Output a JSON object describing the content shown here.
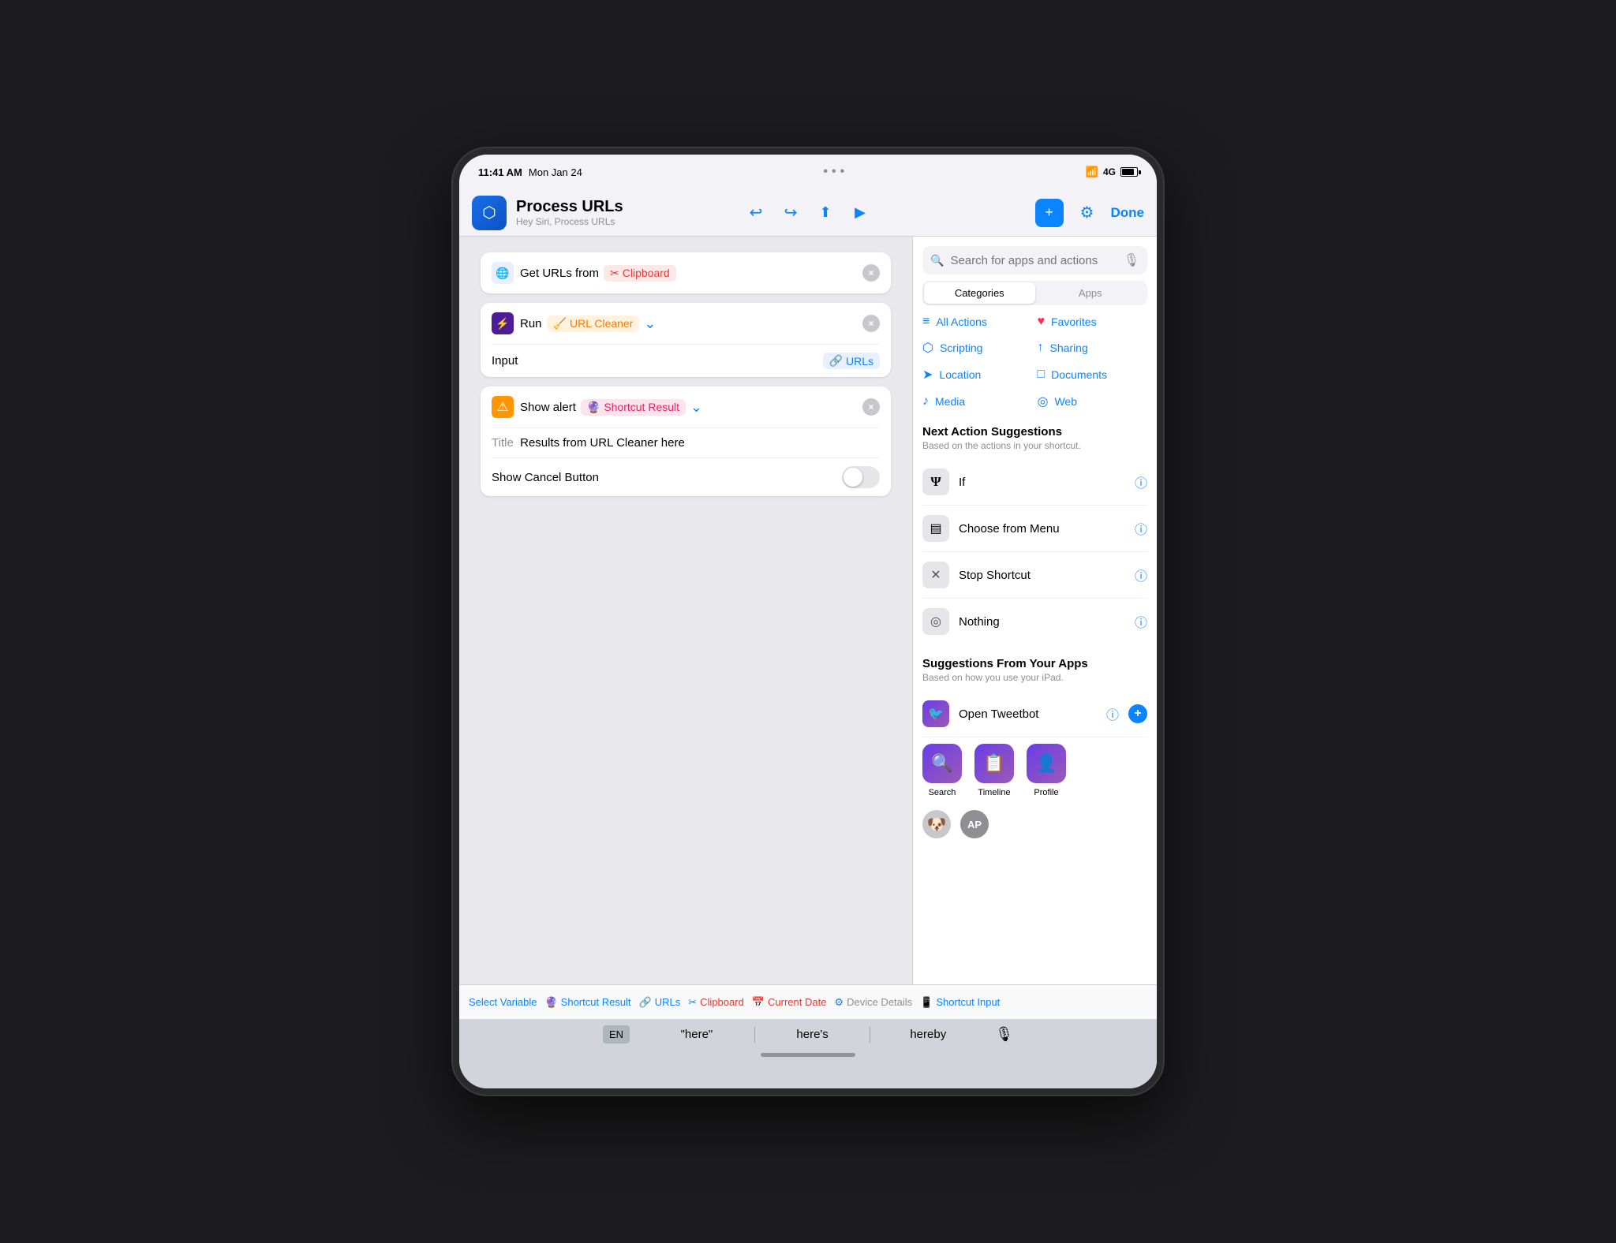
{
  "status_bar": {
    "time": "11:41 AM",
    "date": "Mon Jan 24",
    "signal": "4G"
  },
  "nav": {
    "app_name": "Process URLs",
    "app_subtitle": "Hey Siri, Process URLs",
    "done_label": "Done"
  },
  "actions": [
    {
      "id": "get_urls",
      "title_prefix": "Get URLs from",
      "source_token": "Clipboard"
    },
    {
      "id": "run_shortcut",
      "title_prefix": "Run",
      "shortcut_token": "URL Cleaner",
      "row_label": "Input",
      "row_value": "URLs"
    },
    {
      "id": "show_alert",
      "title_prefix": "Show alert",
      "result_token": "Shortcut Result",
      "title_row_label": "Title",
      "title_row_value": "Results from URL Cleaner here",
      "show_cancel_label": "Show Cancel Button"
    }
  ],
  "right_panel": {
    "search_placeholder": "Search for apps and actions",
    "tab_categories": "Categories",
    "tab_apps": "Apps",
    "categories": [
      {
        "label": "All Actions",
        "icon": "≡"
      },
      {
        "label": "Favorites",
        "icon": "♥"
      },
      {
        "label": "Scripting",
        "icon": "⬡"
      },
      {
        "label": "Sharing",
        "icon": "↑"
      },
      {
        "label": "Location",
        "icon": "➤"
      },
      {
        "label": "Documents",
        "icon": "□"
      },
      {
        "label": "Media",
        "icon": "♪"
      },
      {
        "label": "Web",
        "icon": "◎"
      }
    ],
    "next_action_title": "Next Action Suggestions",
    "next_action_subtitle": "Based on the actions in your shortcut.",
    "next_actions": [
      {
        "id": "if",
        "label": "If",
        "icon": "Y"
      },
      {
        "id": "choose_from_menu",
        "label": "Choose from Menu",
        "icon": "▤"
      },
      {
        "id": "stop_shortcut",
        "label": "Stop Shortcut",
        "icon": "✕"
      },
      {
        "id": "nothing",
        "label": "Nothing",
        "icon": "◎"
      }
    ],
    "suggestions_from_apps_title": "Suggestions From Your Apps",
    "suggestions_from_apps_subtitle": "Based on how you use your iPad.",
    "app_suggestions": [
      {
        "id": "open_tweetbot",
        "label": "Open Tweetbot"
      },
      {
        "id": "search",
        "label": "Search"
      },
      {
        "id": "timeline",
        "label": "Timeline"
      },
      {
        "id": "profile",
        "label": "Profile"
      }
    ]
  },
  "variable_bar": {
    "items": [
      {
        "label": "Select Variable",
        "icon": "",
        "color": "blue"
      },
      {
        "label": "Shortcut Result",
        "icon": "🔵",
        "color": "blue"
      },
      {
        "label": "URLs",
        "icon": "🔗",
        "color": "blue"
      },
      {
        "label": "Clipboard",
        "icon": "✂️",
        "color": "red"
      },
      {
        "label": "Current Date",
        "icon": "📅",
        "color": "red"
      },
      {
        "label": "Device Details",
        "icon": "⚙️",
        "color": "gray"
      },
      {
        "label": "Shortcut Input",
        "icon": "📱",
        "color": "blue"
      }
    ]
  },
  "keyboard": {
    "lang": "EN",
    "suggestions": [
      "\"here\"",
      "here's",
      "hereby"
    ]
  }
}
